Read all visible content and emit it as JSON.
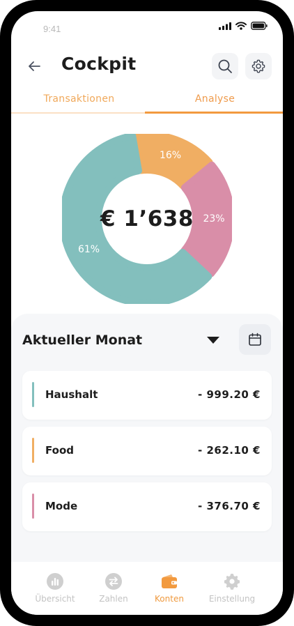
{
  "status": {
    "time": "9:41"
  },
  "header": {
    "title": "Cockpit"
  },
  "tabs": [
    {
      "label": "Transaktionen",
      "active": false
    },
    {
      "label": "Analyse",
      "active": true
    }
  ],
  "chart_data": {
    "type": "pie",
    "center_label": "€ 1’638",
    "slices": [
      {
        "label": "16%",
        "value": 16,
        "color": "#f0ae63"
      },
      {
        "label": "23%",
        "value": 23,
        "color": "#d98ea8"
      },
      {
        "label": "61%",
        "value": 61,
        "color": "#83bfbd"
      }
    ]
  },
  "period": {
    "label": "Aktueller Monat"
  },
  "categories": [
    {
      "name": "Haushalt",
      "amount": "- 999.20 €",
      "color": "#83bfbd"
    },
    {
      "name": "Food",
      "amount": "- 262.10 €",
      "color": "#f0ae63"
    },
    {
      "name": "Mode",
      "amount": "- 376.70 €",
      "color": "#d98ea8"
    }
  ],
  "nav": [
    {
      "label": "Übersicht",
      "icon": "bar-chart-icon",
      "active": false
    },
    {
      "label": "Zahlen",
      "icon": "transfer-icon",
      "active": false
    },
    {
      "label": "Konten",
      "icon": "wallet-icon",
      "active": true
    },
    {
      "label": "Einstellung",
      "icon": "gear-icon",
      "active": false
    }
  ]
}
